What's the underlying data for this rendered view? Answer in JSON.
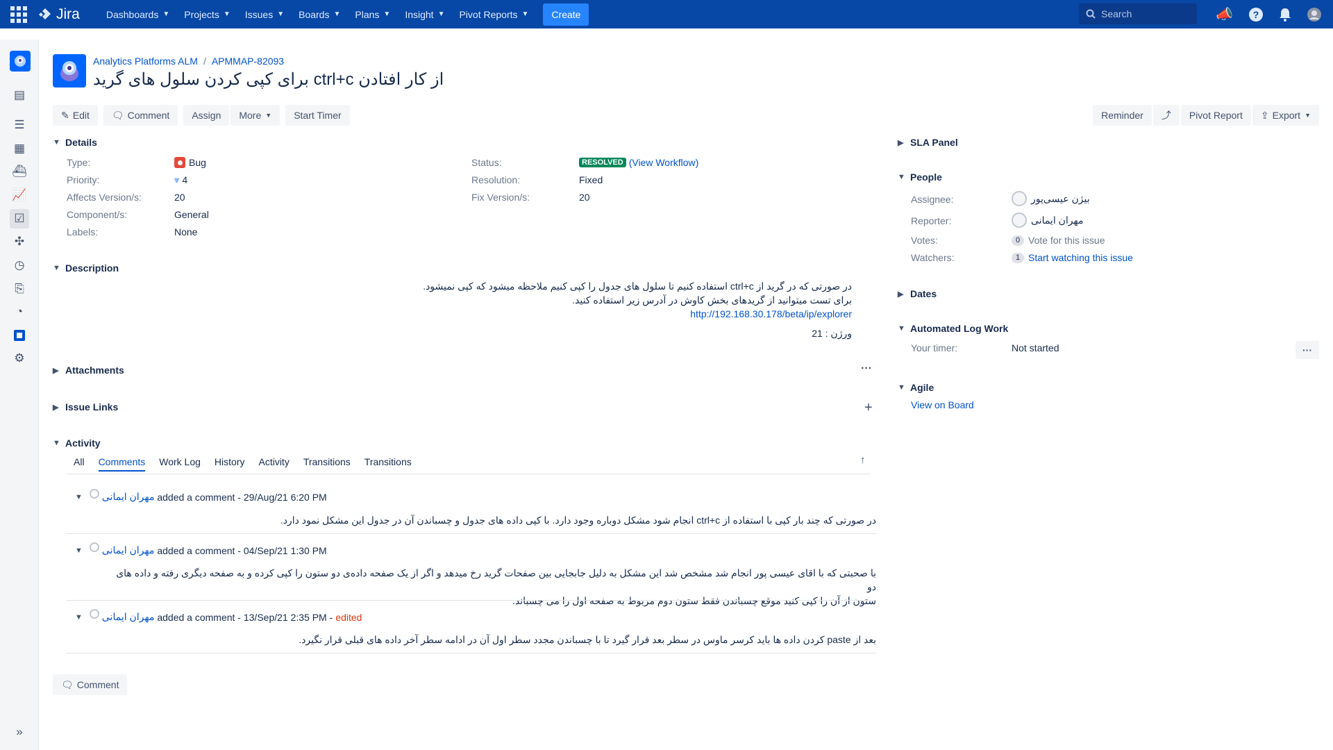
{
  "nav": {
    "logo": "Jira",
    "items": [
      "Dashboards",
      "Projects",
      "Issues",
      "Boards",
      "Plans",
      "Insight",
      "Pivot Reports"
    ],
    "create": "Create",
    "search_placeholder": "Search"
  },
  "breadcrumb": {
    "project": "Analytics Platforms ALM",
    "issue_key": "APMMAP-82093"
  },
  "issue": {
    "title": "از کار افتادن ctrl+c برای کپی کردن سلول های گرید"
  },
  "toolbar": {
    "edit": "Edit",
    "comment": "Comment",
    "assign": "Assign",
    "more": "More",
    "start_timer": "Start Timer"
  },
  "right_toolbar": {
    "reminder": "Reminder",
    "pivot_report": "Pivot Report",
    "export": "Export"
  },
  "details": {
    "heading": "Details",
    "type_label": "Type:",
    "type": "Bug",
    "priority_label": "Priority:",
    "priority": "4",
    "affects_label": "Affects Version/s:",
    "affects": "20",
    "component_label": "Component/s:",
    "component": "General",
    "labels_label": "Labels:",
    "labels": "None",
    "status_label": "Status:",
    "status": "RESOLVED",
    "view_workflow": "(View Workflow)",
    "resolution_label": "Resolution:",
    "resolution": "Fixed",
    "fix_label": "Fix Version/s:",
    "fix": "20"
  },
  "description": {
    "heading": "Description",
    "line1": "در صورتی که در گرید از ctrl+c استفاده کنیم تا سلول های جدول را کپی کنیم ملاحظه میشود که کپی نمیشود.",
    "line2": "برای تست میتوانید از گریدهای بخش کاوش در آدرس زیر استفاده کنید.",
    "link": "http://192.168.30.178/beta/ip/explorer",
    "version": "ورژن : 21"
  },
  "attachments": {
    "heading": "Attachments"
  },
  "issue_links": {
    "heading": "Issue Links"
  },
  "activity": {
    "heading": "Activity",
    "tabs": [
      "All",
      "Comments",
      "Work Log",
      "History",
      "Activity",
      "Transitions",
      "Transitions"
    ]
  },
  "comments": [
    {
      "author": "مهران ایمانی",
      "meta": "added a comment - 29/Aug/21 6:20 PM",
      "edited": "",
      "lines": [
        "در صورتی که چند بار کپی با استفاده از ctrl+c انجام شود مشکل دوباره وجود دارد. با کپی داده های جدول و چسباندن آن در جدول این مشکل نمود دارد."
      ]
    },
    {
      "author": "مهران ایمانی",
      "meta": "added a comment - 04/Sep/21 1:30 PM",
      "edited": "",
      "lines": [
        "با صحبتی که با اقای عیسی پور انجام شد مشخص شد این مشکل به دلیل جابجایی بین صفحات گرید رخ میدهد و اگر از یک صفحه داده‌ی دو ستون را کپی کرده و به صفحه دیگری رفته و داده های دو",
        "ستون از آن را کپی کنید موقع چسباندن فقط ستون دوم مربوط به صفحه اول را می چسباند."
      ]
    },
    {
      "author": "مهران ایمانی",
      "meta": "added a comment - 13/Sep/21 2:35 PM -",
      "edited": "edited",
      "lines": [
        "بعد از paste کردن داده ها باید کرسر ماوس در سطر بعد قرار گیرد تا با چسباندن مجدد سطر اول آن در ادامه سطر آخر داده های قبلی قرار نگیرد."
      ]
    }
  ],
  "comment_button": "Comment",
  "right": {
    "sla": "SLA Panel",
    "people": "People",
    "assignee_label": "Assignee:",
    "assignee": "بیژن عیسی‌پور",
    "reporter_label": "Reporter:",
    "reporter": "مهران ایمانی",
    "votes_label": "Votes:",
    "votes_count": "0",
    "votes_text": "Vote for this issue",
    "watchers_label": "Watchers:",
    "watchers_count": "1",
    "watchers_text": "Start watching this issue",
    "dates": "Dates",
    "log_work": "Automated Log Work",
    "timer_label": "Your timer:",
    "timer": "Not started",
    "agile": "Agile",
    "view_board": "View on Board"
  }
}
